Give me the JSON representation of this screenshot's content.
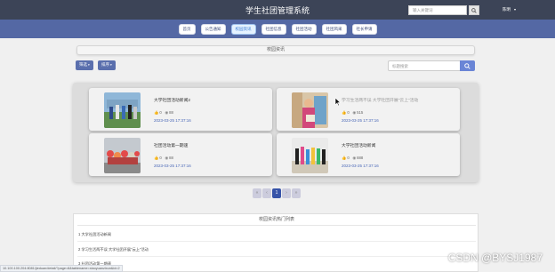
{
  "header": {
    "title": "学生社团管理系统",
    "search_placeholder": "输入关键词",
    "user_name": "陈明",
    "user_caret": "▾"
  },
  "nav": {
    "items": [
      {
        "label": "首页"
      },
      {
        "label": "公告通知"
      },
      {
        "label": "校园资讯"
      },
      {
        "label": "社团信息"
      },
      {
        "label": "社团活动"
      },
      {
        "label": "社团风采"
      },
      {
        "label": "社长申请"
      }
    ],
    "active_index": 2
  },
  "page": {
    "section_title": "校园资讯",
    "filter_label": "筛选",
    "sort_label": "排序",
    "caret": "▾",
    "search_placeholder": "标题搜索"
  },
  "cards": [
    {
      "title": "大学社团活动新闻2",
      "likes": "0",
      "views": "88",
      "date": "2023-03-25 17:37:16",
      "image": "photo-people-outdoor"
    },
    {
      "title": "学习生活两不误 大学社团开展\"云上\"活动",
      "likes": "0",
      "views": "515",
      "date": "2023-03-25 17:37:16",
      "image": "photo-person-indoor"
    },
    {
      "title": "社团活动第一期速",
      "likes": "0",
      "views": "88",
      "date": "2023-03-25 17:37:16",
      "image": "photo-crowd-red"
    },
    {
      "title": "大学社团活动新闻",
      "likes": "0",
      "views": "888",
      "date": "2023-03-25 17:37:16",
      "image": "photo-dance-group"
    }
  ],
  "pager": {
    "prev_first": "«",
    "prev": "‹",
    "current": "1",
    "next": "›",
    "next_last": "»"
  },
  "hot": {
    "title": "校园资讯热门列表",
    "items": [
      {
        "label": "1  大学社团活动新闻"
      },
      {
        "label": "2  学习生活两不误 大学社团开展\"云上\"活动"
      },
      {
        "label": "3  社团活动第一期速"
      }
    ]
  },
  "status_url": "10.100.100.204:8081/jieduan/detail/?page=8&tablename=xiaoyuanzixun&id=2",
  "watermark": "CSDN @BYSJ1987",
  "colors": {
    "topbar": "#3c4457",
    "navbar": "#5468a4",
    "accent": "#5a6fad",
    "date": "#4a68b7",
    "pager_active": "#3653a8"
  }
}
